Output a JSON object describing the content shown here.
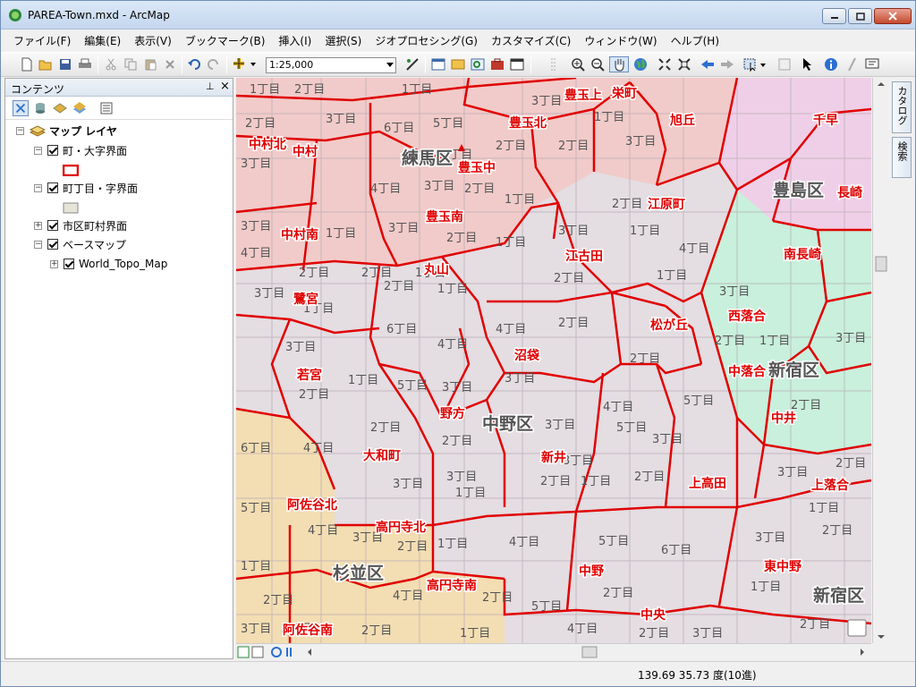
{
  "window": {
    "title": "PAREA-Town.mxd - ArcMap"
  },
  "menu": [
    "ファイル(F)",
    "編集(E)",
    "表示(V)",
    "ブックマーク(B)",
    "挿入(I)",
    "選択(S)",
    "ジオプロセシング(G)",
    "カスタマイズ(C)",
    "ウィンドウ(W)",
    "ヘルプ(H)"
  ],
  "toolbar": {
    "scale": "1:25,000",
    "icons": [
      "new-icon",
      "open-icon",
      "save-icon",
      "print-icon",
      "cut-icon",
      "copy-icon",
      "paste-icon",
      "delete-icon",
      "undo-icon",
      "redo-icon",
      "add-data-icon",
      "zoom-in-icon",
      "zoom-out-icon",
      "pan-icon",
      "globe-icon",
      "identify-icon",
      "select-icon"
    ]
  },
  "toc": {
    "title": "コンテンツ",
    "root": "マップ レイヤ",
    "layers": [
      {
        "label": "町・大字界面",
        "swatch": "#e00000"
      },
      {
        "label": "町丁目・字界面",
        "swatch": "#e6e3d8"
      },
      {
        "label": "市区町村界面"
      },
      {
        "label": "ベースマップ"
      },
      {
        "label": "World_Topo_Map"
      }
    ]
  },
  "dock": {
    "tab1": "カタログ",
    "tab2": "検索"
  },
  "status": {
    "coords": "139.69  35.73 度(10進)"
  },
  "map": {
    "wards": [
      {
        "name": "練馬区"
      },
      {
        "name": "豊島区"
      },
      {
        "name": "中野区"
      },
      {
        "name": "新宿区"
      },
      {
        "name": "杉並区"
      },
      {
        "name": "新宿区"
      }
    ],
    "towns": [
      "豊玉上",
      "栄町",
      "豊玉北",
      "旭丘",
      "千早",
      "中村北",
      "中村",
      "豊玉中",
      "長崎",
      "江原町",
      "豊玉南",
      "中村南",
      "南長崎",
      "江古田",
      "丸山",
      "鷺宮",
      "西落合",
      "松が丘",
      "若宮",
      "沼袋",
      "中落合",
      "野方",
      "中井",
      "大和町",
      "新井",
      "上高田",
      "上落合",
      "阿佐谷北",
      "高円寺北",
      "中野",
      "東中野",
      "高円寺南",
      "中央",
      "阿佐谷南"
    ],
    "chome": [
      "1丁目",
      "2丁目",
      "3丁目",
      "4丁目",
      "5丁目",
      "6丁目"
    ]
  },
  "colors": {
    "boundary": "#e00000",
    "nerima": "#f2c9c6",
    "toshima": "#efcde8",
    "shinjuku": "#c4f2dc",
    "suginami": "#f3dcb0",
    "nakano": "#e4dde2"
  }
}
